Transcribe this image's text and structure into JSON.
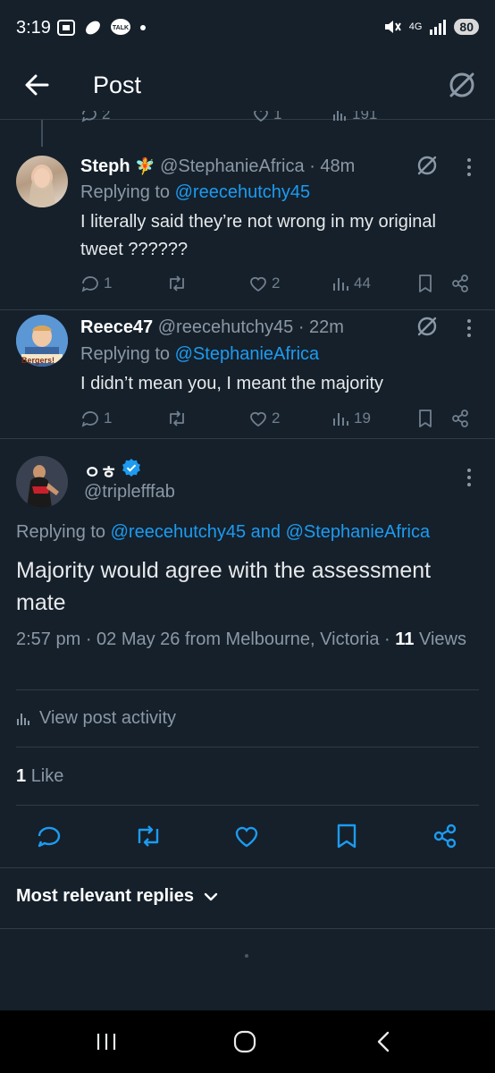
{
  "status_bar": {
    "time": "3:19",
    "network": "4G",
    "battery": "80"
  },
  "header": {
    "title": "Post"
  },
  "top_partial_row": {
    "replies": "2",
    "likes": "1",
    "views": "191"
  },
  "replies": [
    {
      "name": "Steph",
      "emoji": "🧚",
      "handle": "@StephanieAfrica",
      "time": "· 48m",
      "replying_prefix": "Replying to",
      "replying_to": "@reecehutchy45",
      "text": "I literally said they’re not wrong in my original tweet ??????",
      "replies": "1",
      "retweets": "",
      "likes": "2",
      "views": "44"
    },
    {
      "name": "Reece47",
      "handle": "@reecehutchy45",
      "time": "· 22m",
      "replying_prefix": "Replying to",
      "replying_to": "@StephanieAfrica",
      "text": "I didn’t mean you, I meant the majority",
      "avatar_label": "Bergers!",
      "replies": "1",
      "retweets": "",
      "likes": "2",
      "views": "19"
    }
  ],
  "main_post": {
    "name": "ㅇㅎ",
    "handle": "@triplefffab",
    "replying_prefix": "Replying to",
    "replying_to": "@reecehutchy45 and @StephanieAfrica",
    "text": "Majority would agree with the assessment mate",
    "meta_time": "2:57 pm · 02 May 26 from Melbourne, Victoria ·",
    "views_count": "11",
    "views_label": "Views",
    "activity_label": "View post activity",
    "likes_count": "1",
    "likes_label": "Like",
    "sort_label": "Most relevant replies"
  },
  "colors": {
    "background": "#15202b",
    "accent": "#1d9bf0",
    "muted": "#8b98a5"
  }
}
